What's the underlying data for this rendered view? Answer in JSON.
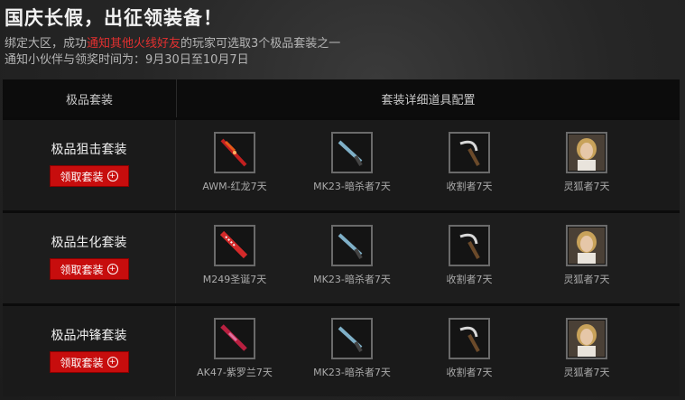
{
  "header": {
    "title": "国庆长假，出征领装备！",
    "line1_pre": "绑定大区，成功",
    "line1_highlight": "通知其他火线好友",
    "line1_post": "的玩家可选取3个极品套装之一",
    "line2": "通知小伙伴与领奖时间为：9月30日至10月7日"
  },
  "table": {
    "col_left": "极品套装",
    "col_right": "套装详细道具配置"
  },
  "button_label": "领取套装",
  "colors": {
    "accent": "#c70d0d",
    "highlight": "#e23030"
  },
  "rows": [
    {
      "name": "极品狙击套装",
      "items": [
        {
          "label": "AWM-红龙7天",
          "icon": "sniper-rifle-icon"
        },
        {
          "label": "MK23-暗杀者7天",
          "icon": "pistol-icon"
        },
        {
          "label": "收割者7天",
          "icon": "sickle-icon"
        },
        {
          "label": "灵狐者7天",
          "icon": "character-portrait-icon"
        }
      ]
    },
    {
      "name": "极品生化套装",
      "items": [
        {
          "label": "M249圣诞7天",
          "icon": "machine-gun-icon"
        },
        {
          "label": "MK23-暗杀者7天",
          "icon": "pistol-icon"
        },
        {
          "label": "收割者7天",
          "icon": "sickle-icon"
        },
        {
          "label": "灵狐者7天",
          "icon": "character-portrait-icon"
        }
      ]
    },
    {
      "name": "极品冲锋套装",
      "items": [
        {
          "label": "AK47-紫罗兰7天",
          "icon": "assault-rifle-icon"
        },
        {
          "label": "MK23-暗杀者7天",
          "icon": "pistol-icon"
        },
        {
          "label": "收割者7天",
          "icon": "sickle-icon"
        },
        {
          "label": "灵狐者7天",
          "icon": "character-portrait-icon"
        }
      ]
    }
  ]
}
